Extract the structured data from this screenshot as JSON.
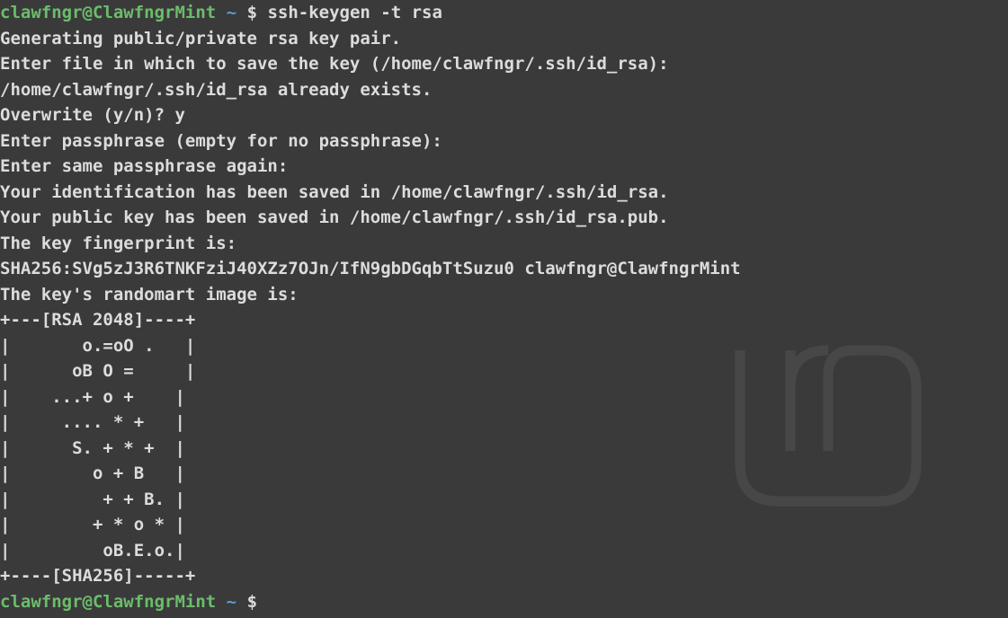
{
  "prompt1": {
    "user_host": "clawfngr@ClawfngrMint",
    "separator": " ",
    "path": "~",
    "dollar": " $ ",
    "command": "ssh-keygen -t rsa"
  },
  "output": {
    "line1": "Generating public/private rsa key pair.",
    "line2": "Enter file in which to save the key (/home/clawfngr/.ssh/id_rsa):",
    "line3": "/home/clawfngr/.ssh/id_rsa already exists.",
    "line4": "Overwrite (y/n)? y",
    "line5": "Enter passphrase (empty for no passphrase):",
    "line6": "Enter same passphrase again:",
    "line7": "Your identification has been saved in /home/clawfngr/.ssh/id_rsa.",
    "line8": "Your public key has been saved in /home/clawfngr/.ssh/id_rsa.pub.",
    "line9": "The key fingerprint is:",
    "line10": "SHA256:SVg5zJ3R6TNKFziJ40XZz7OJn/IfN9gbDGqbTtSuzu0 clawfngr@ClawfngrMint",
    "line11": "The key's randomart image is:",
    "art1": "+---[RSA 2048]----+",
    "art2": "|       o.=oO .   |",
    "art3": "|      oB O =     |",
    "art4": "|    ...+ o +    |",
    "art5": "|     .... * +   |",
    "art6": "|      S. + * +  |",
    "art7": "|        o + B   |",
    "art8": "|         + + B. |",
    "art9": "|        + * o * |",
    "art10": "|         oB.E.o.|",
    "art11": "+----[SHA256]-----+"
  },
  "prompt2": {
    "user_host": "clawfngr@ClawfngrMint",
    "separator": " ",
    "path": "~",
    "dollar": " $"
  }
}
